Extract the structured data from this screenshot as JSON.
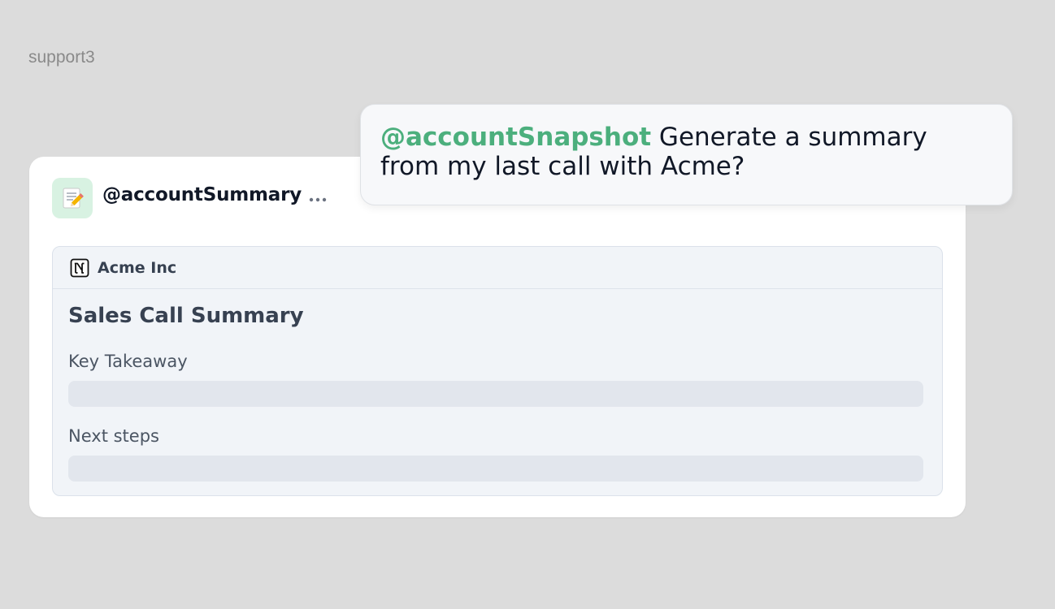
{
  "frame": {
    "label": "support3"
  },
  "agent": {
    "name": "@accountSummary",
    "avatar_icon": "memo-pencil-icon",
    "more_icon": "ellipsis-icon"
  },
  "document": {
    "source_icon": "notion-icon",
    "source": "Acme Inc",
    "title": "Sales Call Summary",
    "fields": [
      {
        "label": "Key Takeaway",
        "value": ""
      },
      {
        "label": "Next steps",
        "value": ""
      }
    ]
  },
  "message": {
    "mention": "@accountSnapshot",
    "text": " Generate a summary from my last call with Acme?"
  },
  "colors": {
    "background": "#dcdcdc",
    "mention": "#4caf7d",
    "avatar_bg": "#d8f2e2",
    "panel_bg": "#f1f4f8",
    "placeholder": "#e2e6ed"
  }
}
